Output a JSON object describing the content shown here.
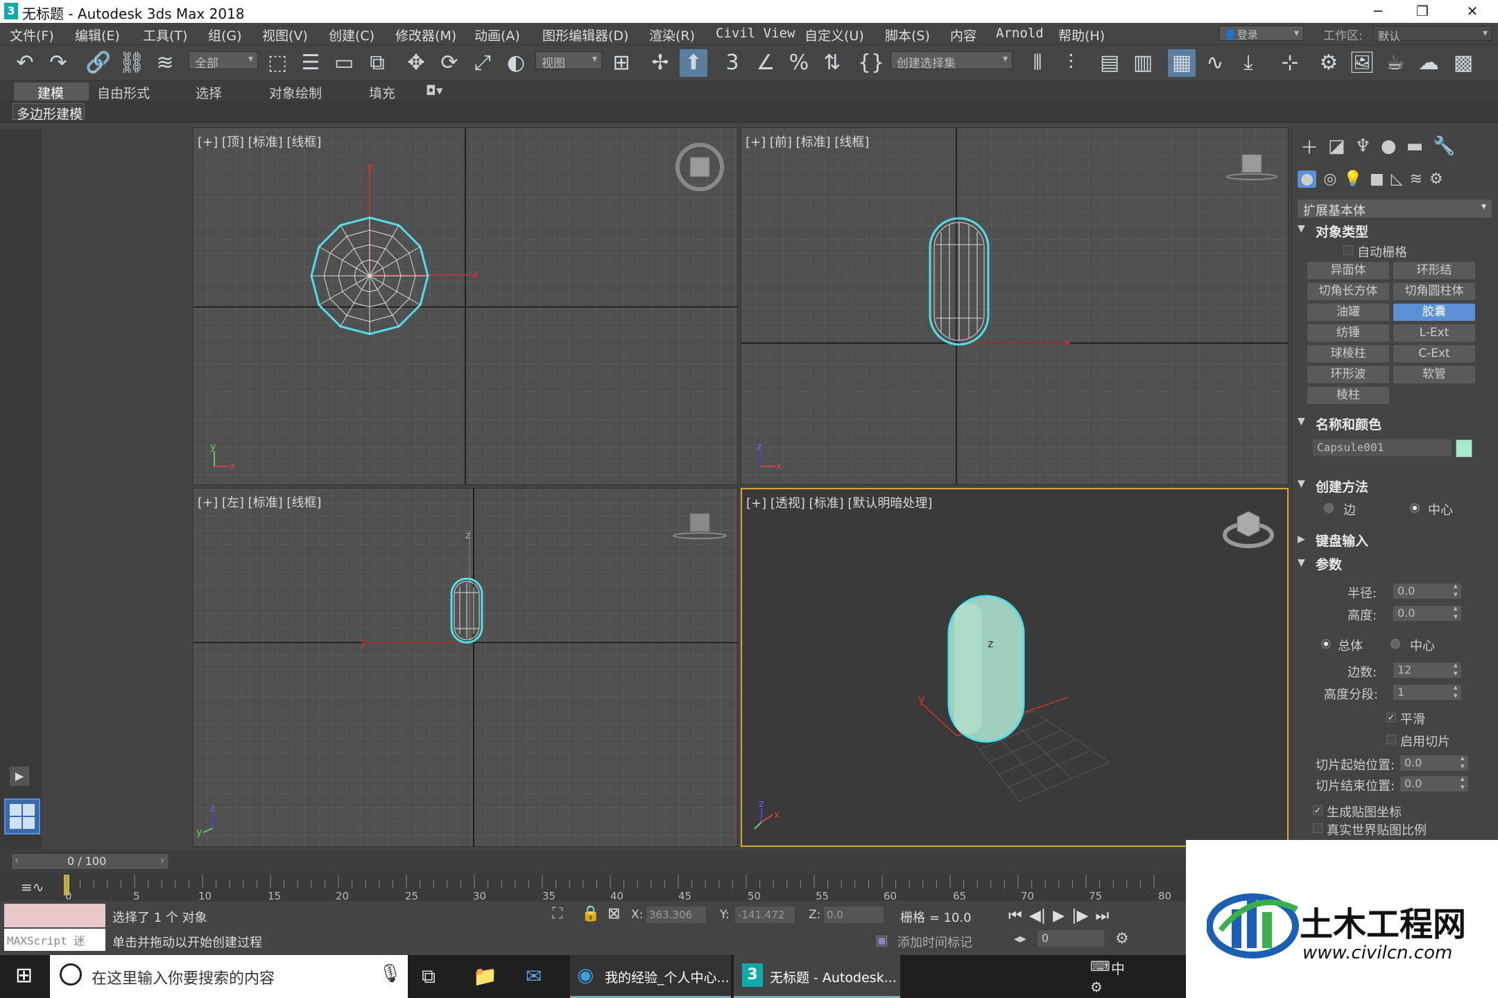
{
  "window": {
    "title": "无标题 - Autodesk 3ds Max 2018",
    "logo": "3"
  },
  "menu": [
    "文件(F)",
    "编辑(E)",
    "工具(T)",
    "组(G)",
    "视图(V)",
    "创建(C)",
    "修改器(M)",
    "动画(A)",
    "图形编辑器(D)",
    "渲染(R)",
    "Civil View",
    "自定义(U)",
    "脚本(S)",
    "内容",
    "Arnold",
    "帮助(H)"
  ],
  "account": {
    "login": "登录",
    "workspace_label": "工作区:",
    "workspace_value": "默认"
  },
  "toolbar": {
    "filter_dropdown": "全部",
    "coord_dropdown": "视图",
    "selset_dropdown": "创建选择集"
  },
  "ribbon": {
    "tabs": [
      "建模",
      "自由形式",
      "选择",
      "对象绘制",
      "填充"
    ],
    "active": "建模",
    "subtab": "多边形建模"
  },
  "viewports": {
    "top": {
      "label": "[+] [顶] [标准] [线框]"
    },
    "front": {
      "label": "[+] [前] [标准] [线框]"
    },
    "left": {
      "label": "[+] [左] [标准] [线框]"
    },
    "persp": {
      "label": "[+] [透视] [标准] [默认明暗处理]"
    },
    "axes": {
      "x": "x",
      "y": "y",
      "z": "z"
    }
  },
  "command_panel": {
    "category": "扩展基本体",
    "object_type": {
      "title": "对象类型",
      "autogrid": "自动栅格",
      "buttons": [
        "异面体",
        "环形结",
        "切角长方体",
        "切角圆柱体",
        "油罐",
        "胶囊",
        "纺锤",
        "L-Ext",
        "球棱柱",
        "C-Ext",
        "环形波",
        "软管",
        "棱柱"
      ],
      "selected": "胶囊"
    },
    "name_color": {
      "title": "名称和颜色",
      "name": "Capsule001",
      "color": "#a8ebd0"
    },
    "creation_method": {
      "title": "创建方法",
      "edge": "边",
      "center": "中心"
    },
    "keyboard": {
      "title": "键盘输入"
    },
    "params": {
      "title": "参数",
      "radius_label": "半径:",
      "radius": "0.0",
      "height_label": "高度:",
      "height": "0.0",
      "overall": "总体",
      "centers": "中心",
      "sides_label": "边数:",
      "sides": "12",
      "hsegs_label": "高度分段:",
      "hsegs": "1",
      "smooth": "平滑",
      "slice_on": "启用切片",
      "slice_from_label": "切片起始位置:",
      "slice_from": "0.0",
      "slice_to_label": "切片结束位置:",
      "slice_to": "0.0",
      "gen_map": "生成贴图坐标",
      "real_world": "真实世界贴图比例"
    }
  },
  "timeline": {
    "frame": "0 / 100",
    "ticks": [
      "0",
      "5",
      "10",
      "15",
      "20",
      "25",
      "30",
      "35",
      "40",
      "45",
      "50",
      "55",
      "60",
      "65",
      "70",
      "75",
      "80"
    ]
  },
  "status": {
    "maxscript": "MAXScript 迷",
    "selected": "选择了 1 个 对象",
    "prompt": "单击并拖动以开始创建过程",
    "x_label": "X:",
    "x": "363.306",
    "y_label": "Y:",
    "y": "-141.472",
    "z_label": "Z:",
    "z": "0.0",
    "grid": "栅格 = 10.0",
    "add_tag": "添加时间标记",
    "frame_field": "0"
  },
  "taskbar": {
    "search": "在这里输入你要搜索的内容",
    "app1": "我的经验_个人中心...",
    "app2": "无标题 - Autodesk...",
    "ime": "中"
  },
  "watermark": {
    "title": "土木工程网",
    "url": "www.civilcn.com"
  },
  "colors": {
    "accent": "#5b8fd6",
    "selection": "#4de0e8",
    "capsule": "#a8ebd0",
    "viewport_active": "#d7a833"
  }
}
